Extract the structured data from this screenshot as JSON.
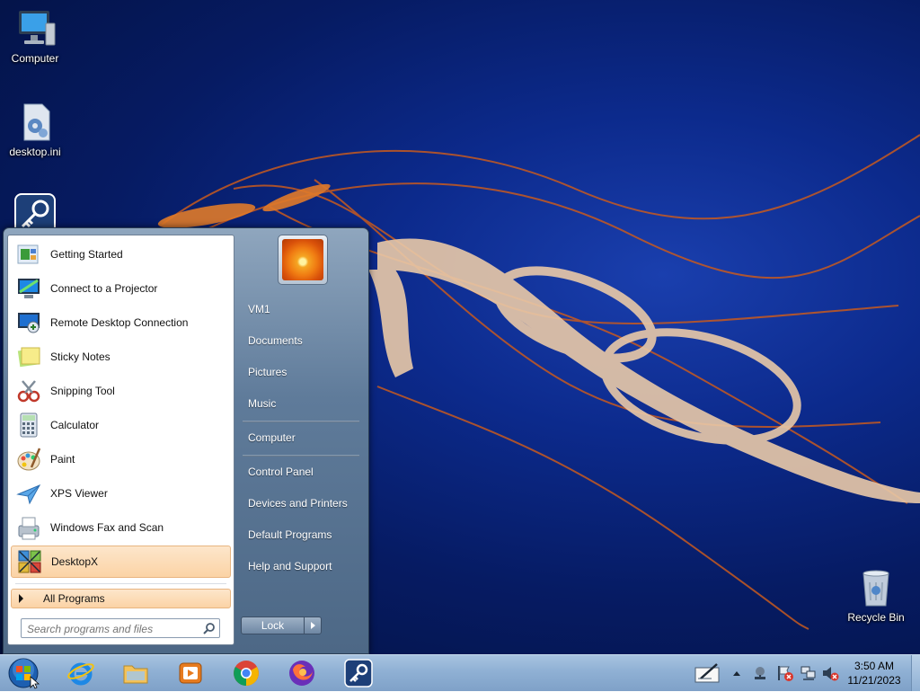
{
  "desktop": {
    "icons": [
      {
        "label": "Computer",
        "icon": "computer-icon"
      },
      {
        "label": "desktop.ini",
        "icon": "settings-file-icon"
      },
      {
        "label": "",
        "icon": "keepass-key-icon"
      },
      {
        "label": "Recycle Bin",
        "icon": "recycle-bin-icon"
      }
    ]
  },
  "start_menu": {
    "programs": [
      {
        "label": "Getting Started",
        "icon": "getting-started-icon"
      },
      {
        "label": "Connect to a Projector",
        "icon": "projector-icon"
      },
      {
        "label": "Remote Desktop Connection",
        "icon": "remote-desktop-icon"
      },
      {
        "label": "Sticky Notes",
        "icon": "sticky-notes-icon"
      },
      {
        "label": "Snipping Tool",
        "icon": "scissors-icon"
      },
      {
        "label": "Calculator",
        "icon": "calculator-icon"
      },
      {
        "label": "Paint",
        "icon": "paint-palette-icon"
      },
      {
        "label": "XPS Viewer",
        "icon": "xps-viewer-icon"
      },
      {
        "label": "Windows Fax and Scan",
        "icon": "fax-icon"
      },
      {
        "label": "DesktopX",
        "icon": "desktopx-icon",
        "highlighted": true
      }
    ],
    "all_programs": "All Programs",
    "search_placeholder": "Search programs and files",
    "right_items": [
      "VM1",
      "Documents",
      "Pictures",
      "Music",
      "Computer",
      "Control Panel",
      "Devices and Printers",
      "Default Programs",
      "Help and Support"
    ],
    "lock_label": "Lock"
  },
  "taskbar": {
    "apps": [
      "internet-explorer-icon",
      "file-explorer-icon",
      "media-player-icon",
      "chrome-icon",
      "firefox-icon",
      "keepass-icon"
    ],
    "tray": [
      "pen-input-icon",
      "show-hidden-icons-icon",
      "network-icon",
      "action-center-icon",
      "network-disconnected-icon",
      "volume-muted-icon"
    ],
    "time": "3:50 AM",
    "date": "11/21/2023"
  },
  "colors": {
    "desktop_blue": "#0c2a8c",
    "highlight": "#fbd3a5",
    "taskbar": "#8fb0d4"
  }
}
